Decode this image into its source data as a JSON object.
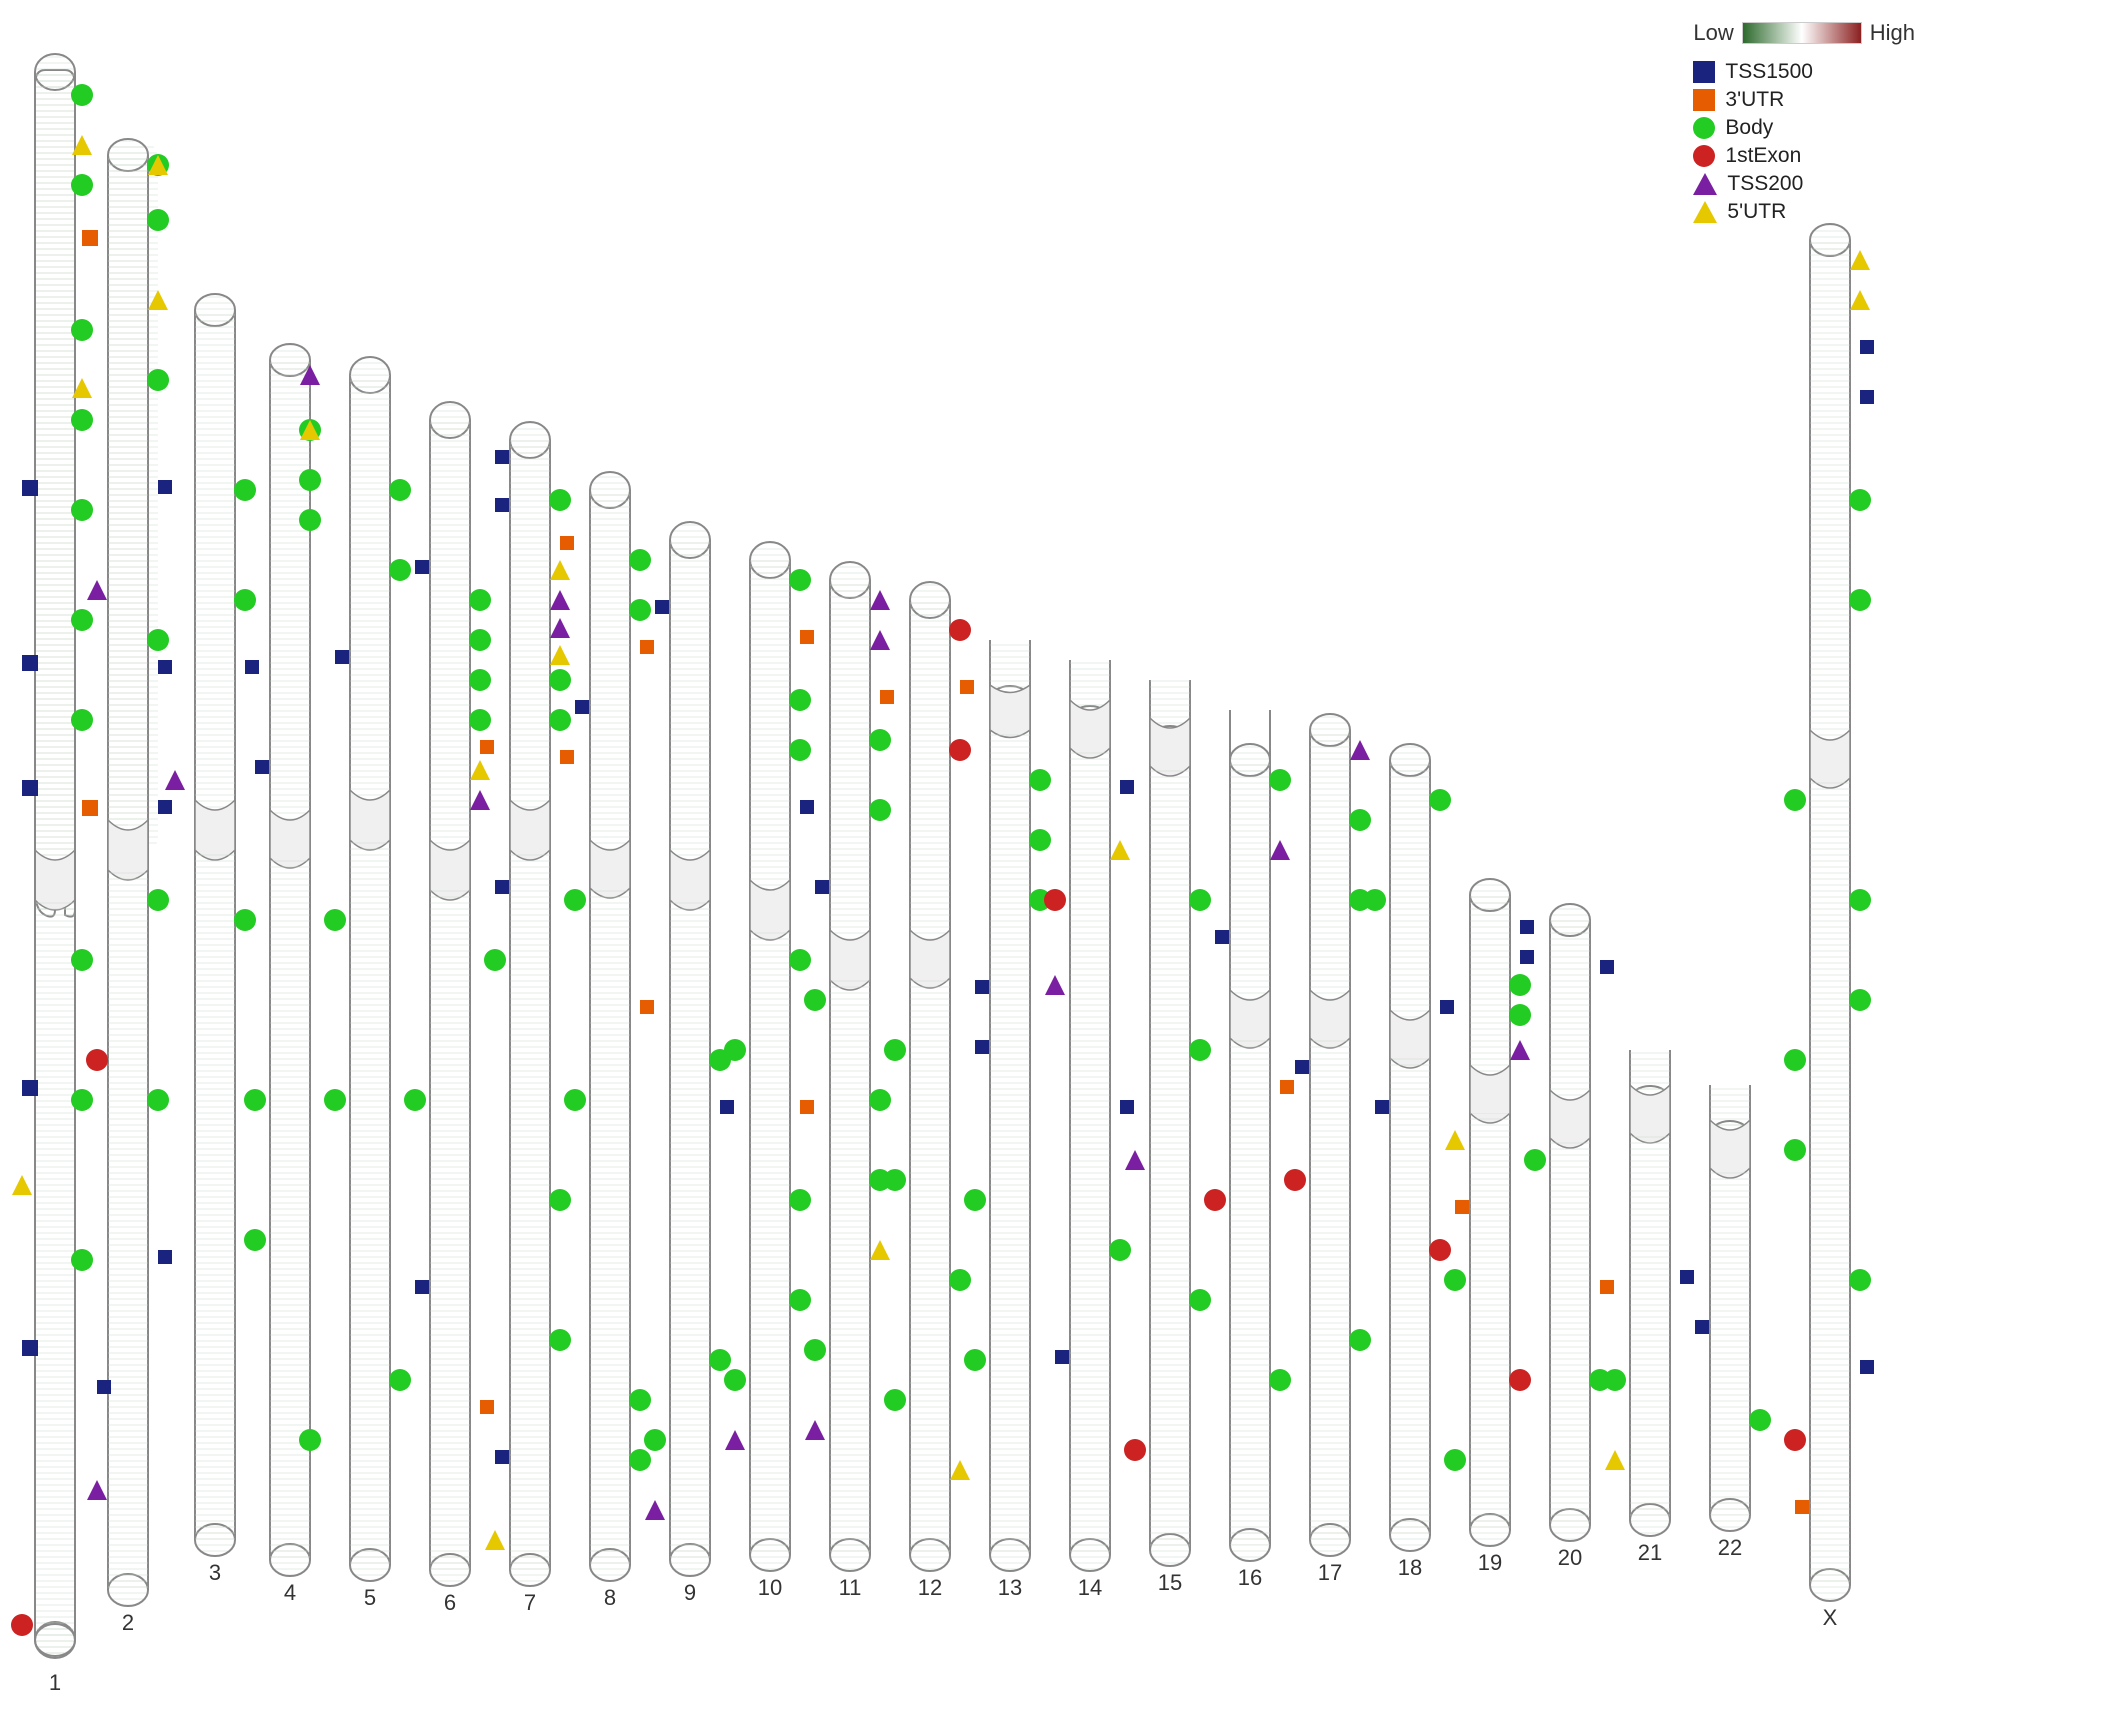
{
  "legend": {
    "gradient_low": "Low",
    "gradient_high": "High",
    "items": [
      {
        "id": "TSS1500",
        "label": "TSS1500",
        "shape": "square",
        "color": "#1a237e"
      },
      {
        "id": "3UTR",
        "label": "3'UTR",
        "shape": "square",
        "color": "#e65c00"
      },
      {
        "id": "Body",
        "label": "Body",
        "shape": "circle",
        "color": "#22cc22"
      },
      {
        "id": "1stExon",
        "label": "1stExon",
        "shape": "circle",
        "color": "#cc2222"
      },
      {
        "id": "TSS200",
        "label": "TSS200",
        "shape": "triangle",
        "color": "#7b1fa2"
      },
      {
        "id": "5UTR",
        "label": "5'UTR",
        "shape": "triangle",
        "color": "#e6c800"
      }
    ]
  },
  "chromosomes": [
    {
      "id": "1",
      "label": "1"
    },
    {
      "id": "2",
      "label": "2"
    },
    {
      "id": "3",
      "label": "3"
    },
    {
      "id": "4",
      "label": "4"
    },
    {
      "id": "5",
      "label": "5"
    },
    {
      "id": "6",
      "label": "6"
    },
    {
      "id": "7",
      "label": "7"
    },
    {
      "id": "8",
      "label": "8"
    },
    {
      "id": "9",
      "label": "9"
    },
    {
      "id": "10",
      "label": "10"
    },
    {
      "id": "11",
      "label": "11"
    },
    {
      "id": "12",
      "label": "12"
    },
    {
      "id": "13",
      "label": "13"
    },
    {
      "id": "14",
      "label": "14"
    },
    {
      "id": "15",
      "label": "15"
    },
    {
      "id": "16",
      "label": "16"
    },
    {
      "id": "17",
      "label": "17"
    },
    {
      "id": "18",
      "label": "18"
    },
    {
      "id": "19",
      "label": "19"
    },
    {
      "id": "20",
      "label": "20"
    },
    {
      "id": "21",
      "label": "21"
    },
    {
      "id": "22",
      "label": "22"
    },
    {
      "id": "X",
      "label": "X"
    }
  ]
}
